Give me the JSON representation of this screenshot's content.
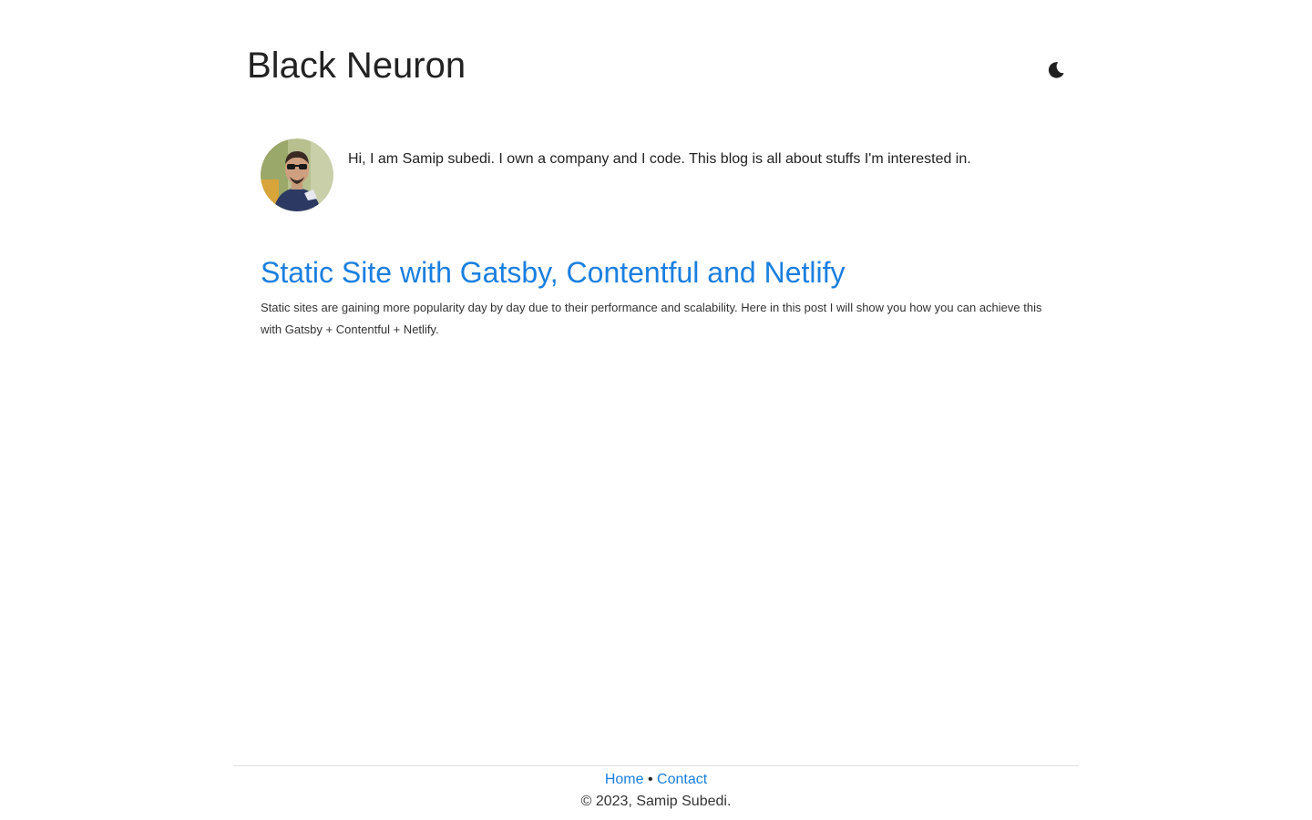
{
  "header": {
    "site_title": "Black Neuron",
    "theme_toggle_icon": "moon-icon"
  },
  "bio": {
    "avatar_alt": "Samip Subedi avatar",
    "text": "Hi, I am Samip subedi. I own a company and I code. This blog is all about stuffs I'm interested in."
  },
  "posts": [
    {
      "title": "Static Site with Gatsby, Contentful and Netlify",
      "excerpt": "Static sites are gaining more popularity day by day due to their performance and scalability. Here in this post I will show you how you can achieve this with Gatsby + Contentful + Netlify."
    }
  ],
  "footer": {
    "home_label": "Home",
    "separator": "•",
    "contact_label": "Contact",
    "copyright": "© 2023, Samip Subedi."
  },
  "colors": {
    "link": "#1a7fe0",
    "text": "#222222",
    "background": "#ffffff"
  }
}
